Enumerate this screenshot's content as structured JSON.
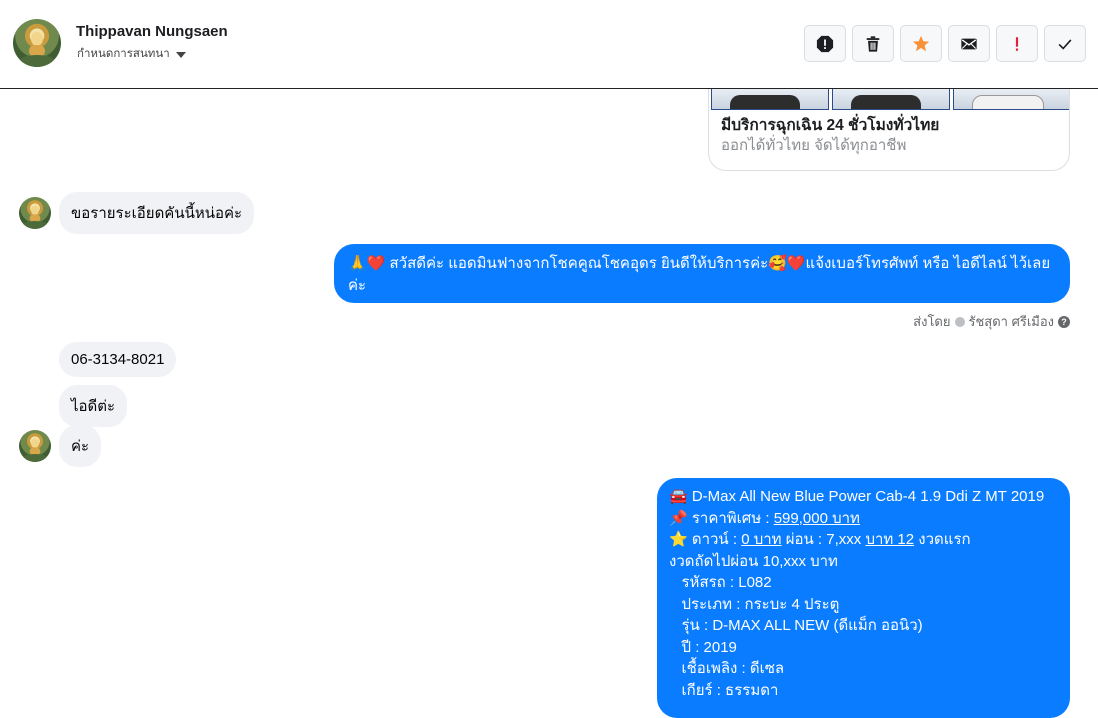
{
  "header": {
    "name": "Thippavan Nungsaen",
    "subtitle": "กำหนดการสนทนา"
  },
  "toolbar": {
    "icons": [
      "spam-icon",
      "trash-icon",
      "star-icon",
      "mail-icon",
      "important-icon",
      "check-icon"
    ],
    "star_color": "#f7923a",
    "important_color": "#e41e3f"
  },
  "card": {
    "title": "มีบริการฉุกเฉิน 24 ชั่วโมงทั่วไทย",
    "subtitle": "ออกได้ทั่วไทย จัดได้ทุกอาชีพ"
  },
  "messages": {
    "in1": "ขอรายระเอียดคันนี้หน่อค่ะ",
    "out1": "🙏❤️ สวัสดีค่ะ แอดมินฟางจากโชคคูณโชคอุดร ยินดีให้บริการค่ะ🥰❤️แจ้งเบอร์โทรศัพท์ หรือ ไอดีไลน์  ไว้เลยค่ะ",
    "sent_by_label": "ส่งโดย",
    "sent_by_name": "รัชสุดา ศรีเมือง",
    "in2": "06-3134-8021",
    "in3": "ไอดีต่ะ",
    "in4": "ค่ะ",
    "out2": {
      "l1": "🚘 D-Max All New Blue Power Cab-4 1.9 Ddi Z MT 2019",
      "l2a": "📌 ราคาพิเศษ : ",
      "l2b": "599,000 บาท",
      "l3a": "⭐ ดาวน์ : ",
      "l3b": "0 บาท",
      "l3c": " ผ่อน : 7,xxx ",
      "l3d": "บาท 12",
      "l3e": " งวดแรก",
      "l4": "งวดถัดไปผ่อน  10,xxx บาท",
      "l5": "   รหัสรถ : L082",
      "l6": "   ประเภท : กระบะ 4 ประตู",
      "l7": "   รุ่น : D-MAX ALL NEW (ดีแม็ก ออนิว)",
      "l8": "   ปี : 2019",
      "l9": "   เชื้อเพลิง : ดีเซล",
      "l10": "   เกียร์ : ธรรมดา"
    }
  },
  "colors": {
    "outgoing_bubble": "#0a7cff",
    "incoming_bubble": "#f0f2f5"
  }
}
